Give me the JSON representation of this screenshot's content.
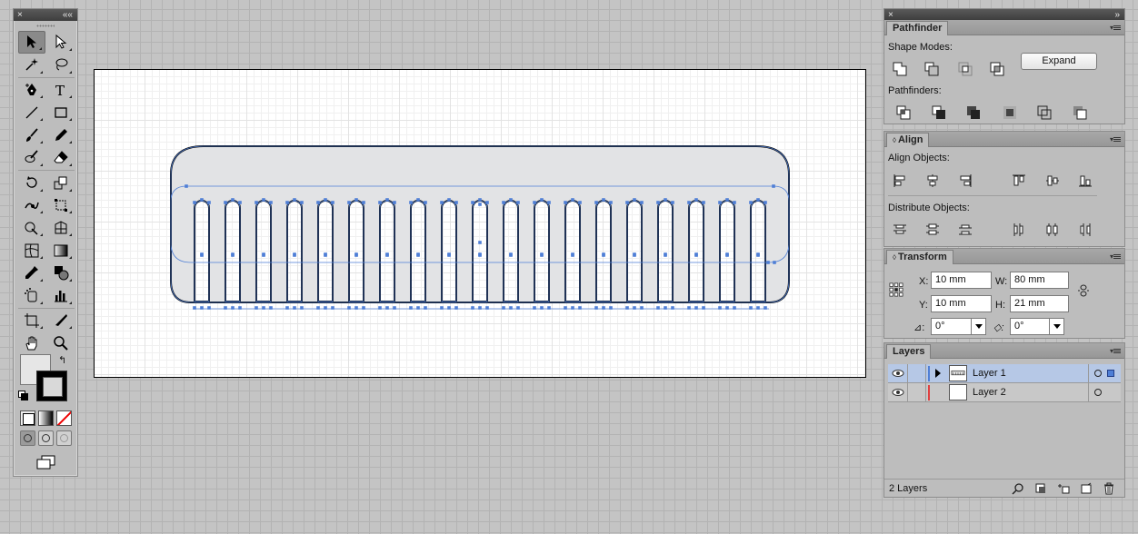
{
  "tools_panel": {
    "close_glyph": "×",
    "collapse_glyph": "««",
    "tools": [
      {
        "name": "selection-tool",
        "icon": "arrow-icon"
      },
      {
        "name": "direct-selection-tool",
        "icon": "white-arrow-icon"
      },
      {
        "name": "magic-wand-tool",
        "icon": "magic-wand-icon"
      },
      {
        "name": "lasso-tool",
        "icon": "lasso-icon"
      },
      {
        "name": "pen-tool",
        "icon": "pen-icon"
      },
      {
        "name": "type-tool",
        "icon": "type-icon"
      },
      {
        "name": "line-tool",
        "icon": "line-icon"
      },
      {
        "name": "rectangle-tool",
        "icon": "rectangle-icon"
      },
      {
        "name": "paintbrush-tool",
        "icon": "brush-icon"
      },
      {
        "name": "pencil-tool",
        "icon": "pencil-icon"
      },
      {
        "name": "blob-brush-tool",
        "icon": "blob-brush-icon"
      },
      {
        "name": "eraser-tool",
        "icon": "eraser-icon"
      },
      {
        "name": "rotate-tool",
        "icon": "rotate-icon"
      },
      {
        "name": "scale-tool",
        "icon": "scale-icon"
      },
      {
        "name": "warp-tool",
        "icon": "warp-icon"
      },
      {
        "name": "free-transform-tool",
        "icon": "free-transform-icon"
      },
      {
        "name": "shape-builder-tool",
        "icon": "shape-builder-icon"
      },
      {
        "name": "perspective-grid-tool",
        "icon": "perspective-grid-icon"
      },
      {
        "name": "mesh-tool",
        "icon": "mesh-icon"
      },
      {
        "name": "gradient-tool",
        "icon": "gradient-icon"
      },
      {
        "name": "eyedropper-tool",
        "icon": "eyedropper-icon"
      },
      {
        "name": "blend-tool",
        "icon": "blend-icon"
      },
      {
        "name": "symbol-sprayer-tool",
        "icon": "symbol-sprayer-icon"
      },
      {
        "name": "column-graph-tool",
        "icon": "column-graph-icon"
      },
      {
        "name": "artboard-tool",
        "icon": "artboard-icon"
      },
      {
        "name": "slice-tool",
        "icon": "slice-icon"
      },
      {
        "name": "hand-tool",
        "icon": "hand-icon"
      },
      {
        "name": "zoom-tool",
        "icon": "zoom-icon"
      }
    ],
    "fill_color": "#e6e6e6",
    "stroke_color": "#000000"
  },
  "pathfinder": {
    "tab_label": "Pathfinder",
    "shape_modes_label": "Shape Modes:",
    "expand_label": "Expand",
    "pathfinders_label": "Pathfinders:",
    "shape_mode_icons": [
      "unite-icon",
      "minus-front-icon",
      "intersect-icon",
      "exclude-icon"
    ],
    "pathfinder_icons": [
      "divide-icon",
      "trim-icon",
      "merge-icon",
      "crop-icon",
      "outline-icon",
      "minus-back-icon"
    ]
  },
  "align": {
    "tab_label": "Align",
    "align_objects_label": "Align Objects:",
    "distribute_objects_label": "Distribute Objects:"
  },
  "transform": {
    "tab_label": "Transform",
    "x_label": "X:",
    "x_value": "10 mm",
    "y_label": "Y:",
    "y_value": "10 mm",
    "w_label": "W:",
    "w_value": "80 mm",
    "h_label": "H:",
    "h_value": "21 mm",
    "rotate_value": "0°",
    "shear_value": "0°"
  },
  "layers": {
    "tab_label": "Layers",
    "rows": [
      {
        "name": "Layer 1",
        "color": "#4f7fd6",
        "selected": true
      },
      {
        "name": "Layer 2",
        "color": "#e04040",
        "selected": false
      }
    ],
    "count_label": "2 Layers"
  },
  "colors": {
    "selection_blue": "#4f7fd6",
    "comb_fill": "#e2e3e5"
  }
}
